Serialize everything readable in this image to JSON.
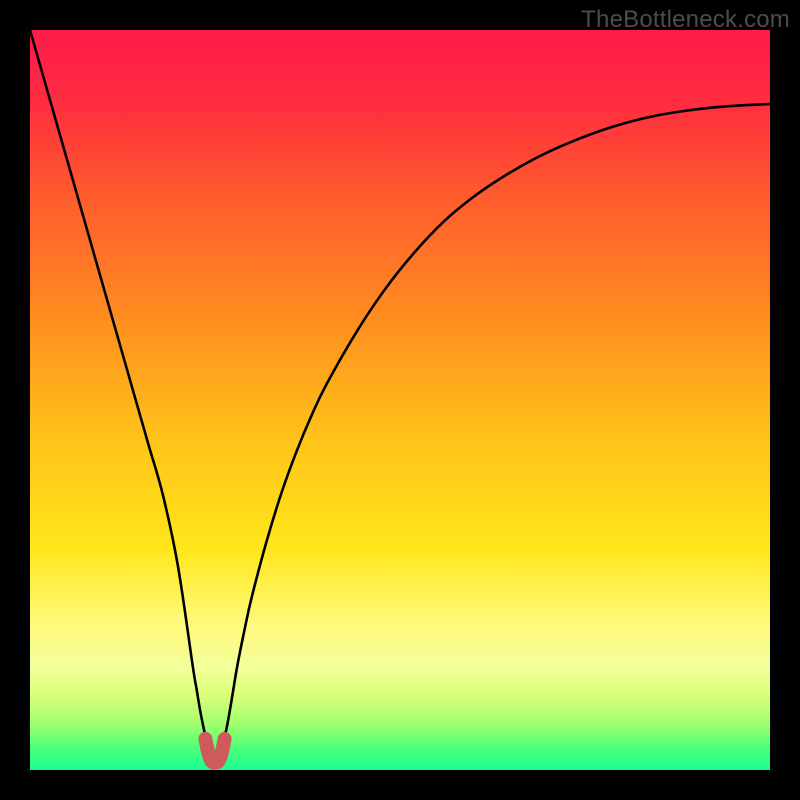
{
  "watermark": "TheBottleneck.com",
  "colors": {
    "gradient_stops": [
      {
        "offset": 0.0,
        "color": "#ff1a4b"
      },
      {
        "offset": 0.1,
        "color": "#ff2d3f"
      },
      {
        "offset": 0.22,
        "color": "#ff5a2e"
      },
      {
        "offset": 0.38,
        "color": "#ff8a20"
      },
      {
        "offset": 0.55,
        "color": "#ffc21a"
      },
      {
        "offset": 0.7,
        "color": "#ffe61a"
      },
      {
        "offset": 0.8,
        "color": "#fff97a"
      },
      {
        "offset": 0.86,
        "color": "#f4ff9a"
      },
      {
        "offset": 0.9,
        "color": "#d8ff7a"
      },
      {
        "offset": 0.94,
        "color": "#9bff6e"
      },
      {
        "offset": 0.97,
        "color": "#4dff7a"
      },
      {
        "offset": 1.0,
        "color": "#1aff8f"
      }
    ],
    "curve": "#000000",
    "marker": "#cf5a5a"
  },
  "chart_data": {
    "type": "line",
    "title": "",
    "xlabel": "",
    "ylabel": "",
    "xlim": [
      0,
      100
    ],
    "ylim": [
      0,
      100
    ],
    "grid": false,
    "legend": false,
    "x": [
      0,
      2,
      4,
      6,
      8,
      10,
      12,
      14,
      16,
      18,
      20,
      22,
      22.5,
      23,
      23.5,
      24,
      24.5,
      25,
      25.5,
      26,
      26.3,
      26.6,
      27,
      27.5,
      28,
      29,
      30,
      32,
      34,
      36,
      38,
      40,
      44,
      48,
      52,
      56,
      60,
      64,
      68,
      72,
      76,
      80,
      84,
      88,
      92,
      96,
      100
    ],
    "series": [
      {
        "name": "bottleneck-curve",
        "values": [
          100,
          93,
          86,
          79,
          72,
          65,
          58,
          51,
          44,
          37,
          27.5,
          14,
          11,
          8,
          5.5,
          3.3,
          1.8,
          1,
          1.8,
          3.3,
          4.5,
          5.8,
          8,
          11,
          14,
          19,
          23.5,
          31,
          37.5,
          43,
          47.8,
          52,
          59,
          65,
          70,
          74.2,
          77.5,
          80.2,
          82.5,
          84.4,
          86,
          87.3,
          88.3,
          89,
          89.5,
          89.8,
          90
        ]
      }
    ],
    "valley_marker": {
      "x": [
        23.7,
        24.0,
        24.3,
        24.6,
        25.0,
        25.4,
        25.7,
        26.0,
        26.3
      ],
      "y": [
        4.2,
        2.7,
        1.7,
        1.1,
        1.0,
        1.1,
        1.7,
        2.7,
        4.2
      ]
    }
  }
}
